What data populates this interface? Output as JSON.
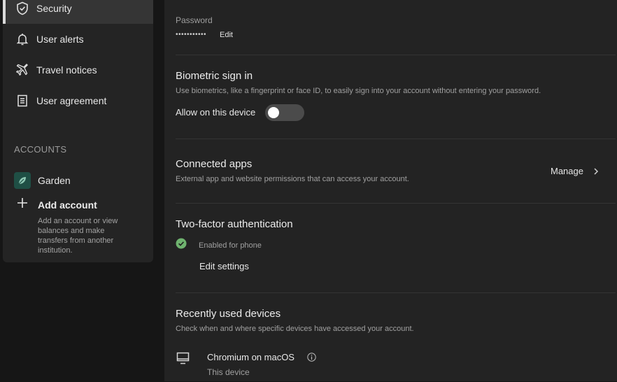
{
  "sidebar": {
    "nav": [
      {
        "label": "Security",
        "icon": "shield-check-icon",
        "active": true
      },
      {
        "label": "User alerts",
        "icon": "bell-icon"
      },
      {
        "label": "Travel notices",
        "icon": "airplane-icon"
      },
      {
        "label": "User agreement",
        "icon": "document-icon"
      }
    ],
    "accounts_title": "ACCOUNTS",
    "account": {
      "name": "Garden",
      "icon": "leaf-icon"
    },
    "add_account": {
      "label": "Add account",
      "description": "Add an account or view balances and make transfers from another institution."
    }
  },
  "password": {
    "label": "Password",
    "mask": "•••••••••••",
    "edit_label": "Edit"
  },
  "biometric": {
    "title": "Biometric sign in",
    "description": "Use biometrics, like a fingerprint or face ID, to easily sign into your account without entering your password.",
    "toggle_label": "Allow on this device",
    "enabled": false
  },
  "connected_apps": {
    "title": "Connected apps",
    "description": "External app and website permissions that can access your account.",
    "manage_label": "Manage"
  },
  "two_factor": {
    "title": "Two-factor authentication",
    "status": "Enabled for phone",
    "edit_label": "Edit settings"
  },
  "devices": {
    "title": "Recently used devices",
    "description": "Check when and where specific devices have accessed your account.",
    "items": [
      {
        "name": "Chromium on macOS",
        "sub": "This device",
        "icon": "monitor-icon"
      }
    ]
  },
  "colors": {
    "background": "#161616",
    "panel": "#232323",
    "sidebar": "#242424",
    "success": "#6fb36f",
    "account_avatar": "#1f4f45"
  }
}
